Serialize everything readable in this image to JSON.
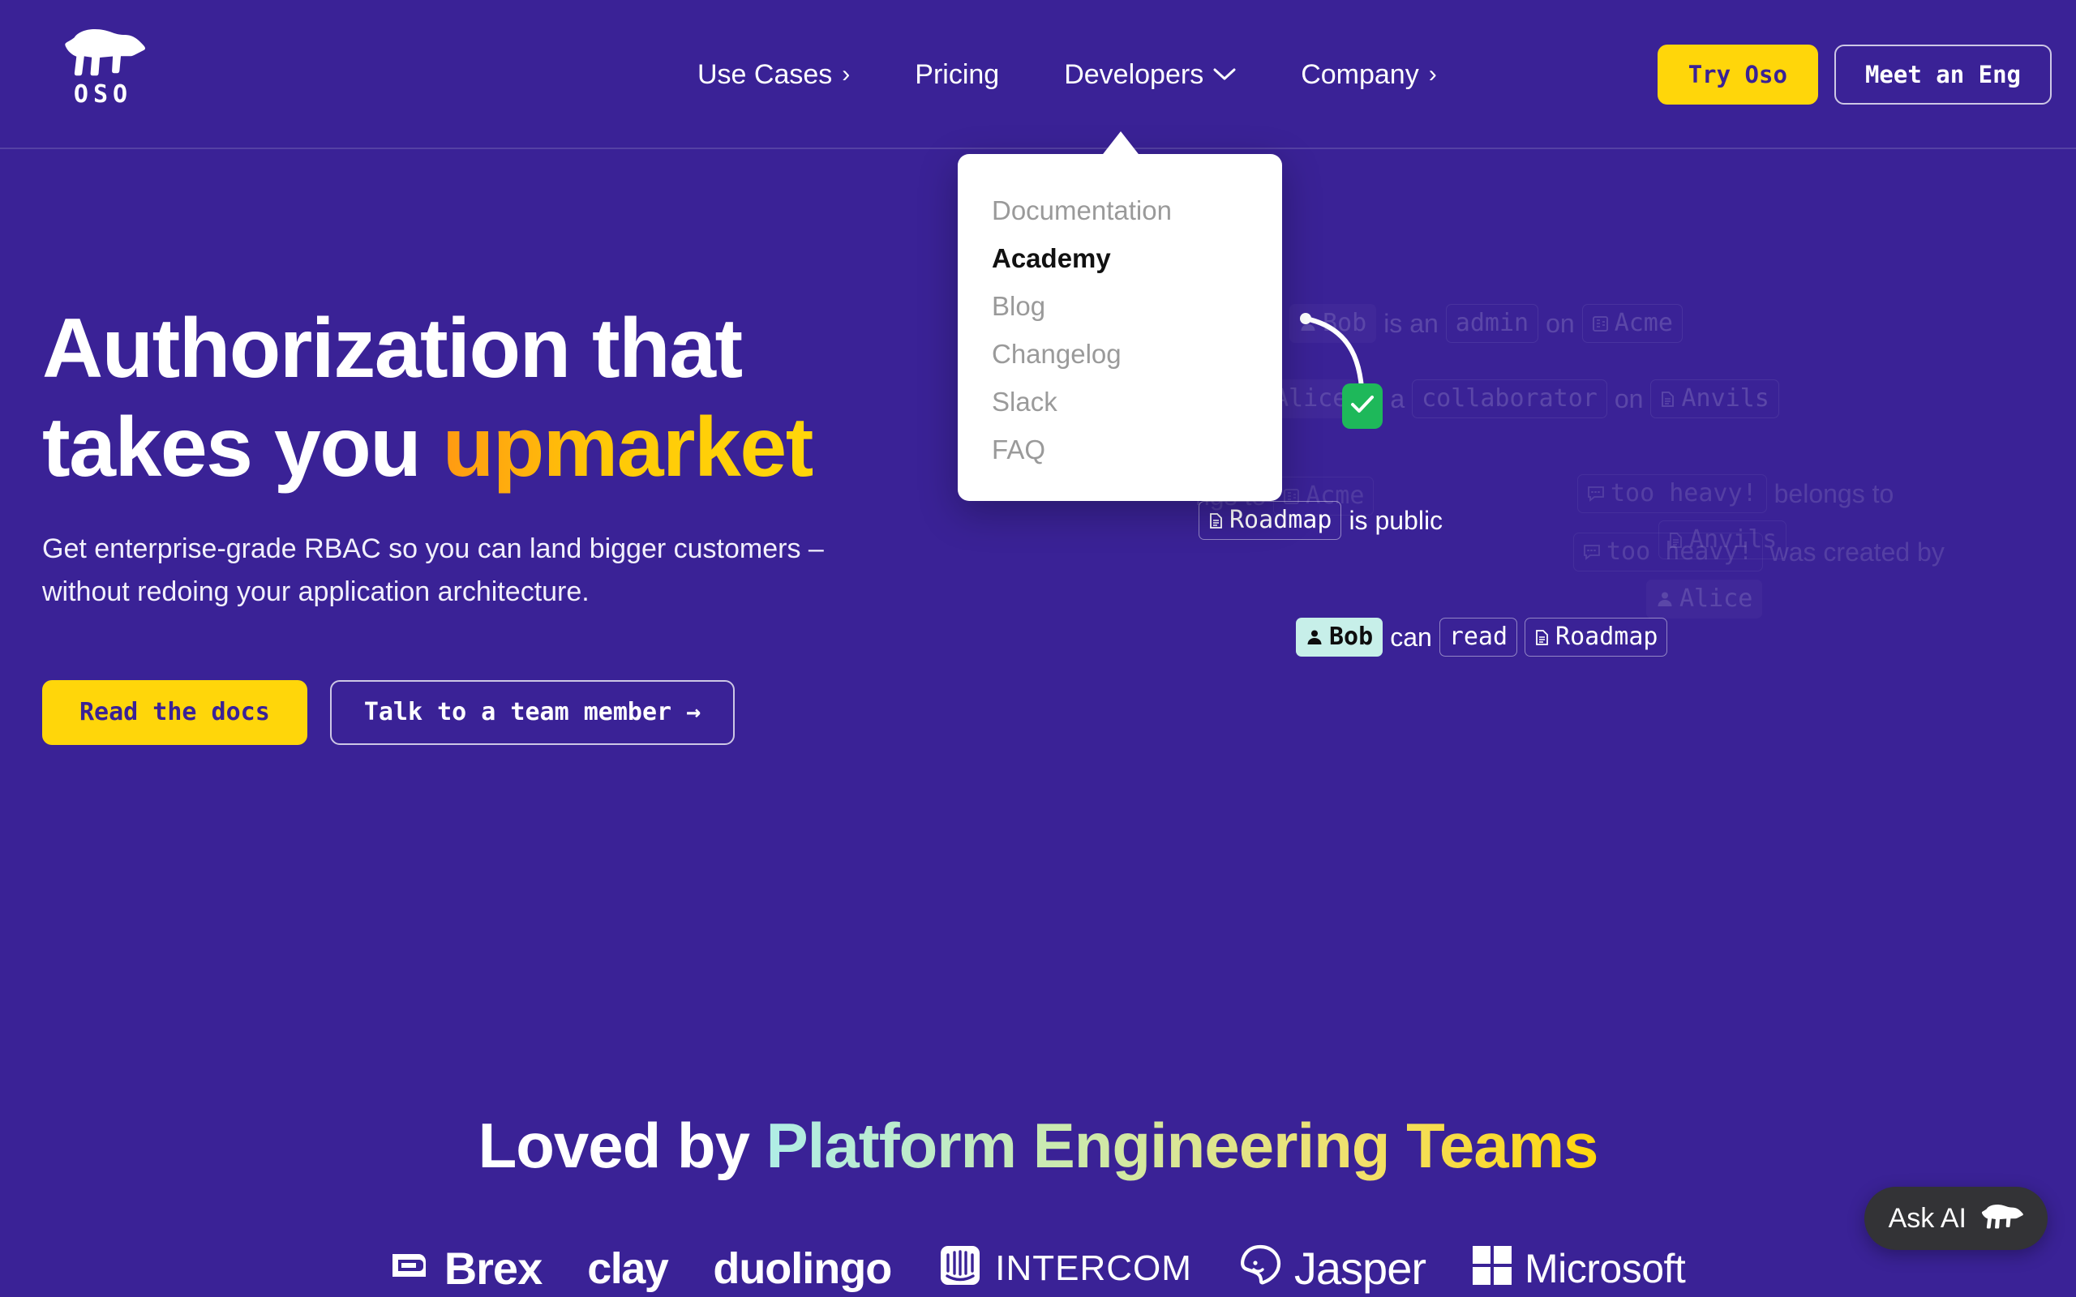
{
  "brand": {
    "name": "OSO",
    "logo_icon": "polar-bear-icon",
    "bg_color": "#3A2296",
    "accent_yellow": "#FFD60A"
  },
  "nav": {
    "items": [
      {
        "label": "Use Cases",
        "indicator": "›",
        "type": "chevron-right-icon"
      },
      {
        "label": "Pricing",
        "indicator": "",
        "type": "none"
      },
      {
        "label": "Developers",
        "indicator": "⌄",
        "type": "chevron-down-icon"
      },
      {
        "label": "Company",
        "indicator": "›",
        "type": "chevron-right-icon"
      }
    ],
    "cta_primary": "Try Oso",
    "cta_secondary": "Meet an Eng"
  },
  "dropdown": {
    "open_for": "Developers",
    "items": [
      {
        "label": "Documentation",
        "active": false
      },
      {
        "label": "Academy",
        "active": true
      },
      {
        "label": "Blog",
        "active": false
      },
      {
        "label": "Changelog",
        "active": false
      },
      {
        "label": "Slack",
        "active": false
      },
      {
        "label": "FAQ",
        "active": false
      }
    ]
  },
  "hero": {
    "headline_line1": "Authorization that",
    "headline_line2_plain": "takes you ",
    "headline_line2_accent": "upmarket",
    "subhead_line1": "Get enterprise-grade RBAC so you can land bigger customers –",
    "subhead_line2": "without redoing your application architecture.",
    "cta_primary": "Read the docs",
    "cta_secondary": "Talk to a team member →"
  },
  "graphic": {
    "statements": [
      {
        "subject": "Bob",
        "subject_icon": "person-icon",
        "verb": "is an",
        "object": "admin",
        "object_icon": "none",
        "preposition": "on",
        "target": "Acme",
        "target_icon": "building-icon",
        "state": "faded"
      },
      {
        "subject": "Alice",
        "subject_icon": "person-icon",
        "verb": "is a",
        "object": "collaborator",
        "object_icon": "none",
        "preposition": "on",
        "target": "Anvils",
        "target_icon": "document-icon",
        "state": "faded"
      },
      {
        "partial_text": "ngs to",
        "target": "Acme",
        "target_icon": "building-icon",
        "state": "faded"
      },
      {
        "subject": "too heavy!",
        "subject_icon": "comment-icon",
        "verb": "belongs to",
        "target": "Anvils",
        "target_icon": "document-icon",
        "state": "faded"
      },
      {
        "subject": "too heavy!",
        "subject_icon": "comment-icon",
        "verb": "was created by",
        "target": "Alice",
        "target_icon": "person-icon",
        "state": "faded"
      }
    ],
    "highlight_top": {
      "subject": "Roadmap",
      "subject_icon": "document-icon",
      "verb": "is public"
    },
    "check_badge": {
      "icon": "checkmark-icon",
      "color": "#1EB85A"
    },
    "highlight_bottom": {
      "subject": "Bob",
      "subject_icon": "person-icon",
      "verb": "can",
      "action": "read",
      "target": "Roadmap",
      "target_icon": "document-icon"
    }
  },
  "social_proof": {
    "heading_plain": "Loved by ",
    "heading_gradient": "Platform Engineering Teams",
    "logos": [
      {
        "name": "Brex",
        "icon": "brex-square-icon"
      },
      {
        "name": "clay",
        "icon": "none"
      },
      {
        "name": "duolingo",
        "icon": "none"
      },
      {
        "name": "INTERCOM",
        "icon": "intercom-icon"
      },
      {
        "name": "Jasper",
        "icon": "jasper-smiley-icon"
      },
      {
        "name": "Microsoft",
        "icon": "microsoft-squares-icon"
      }
    ]
  },
  "ask_ai": {
    "label": "Ask AI",
    "icon": "polar-bear-icon"
  }
}
